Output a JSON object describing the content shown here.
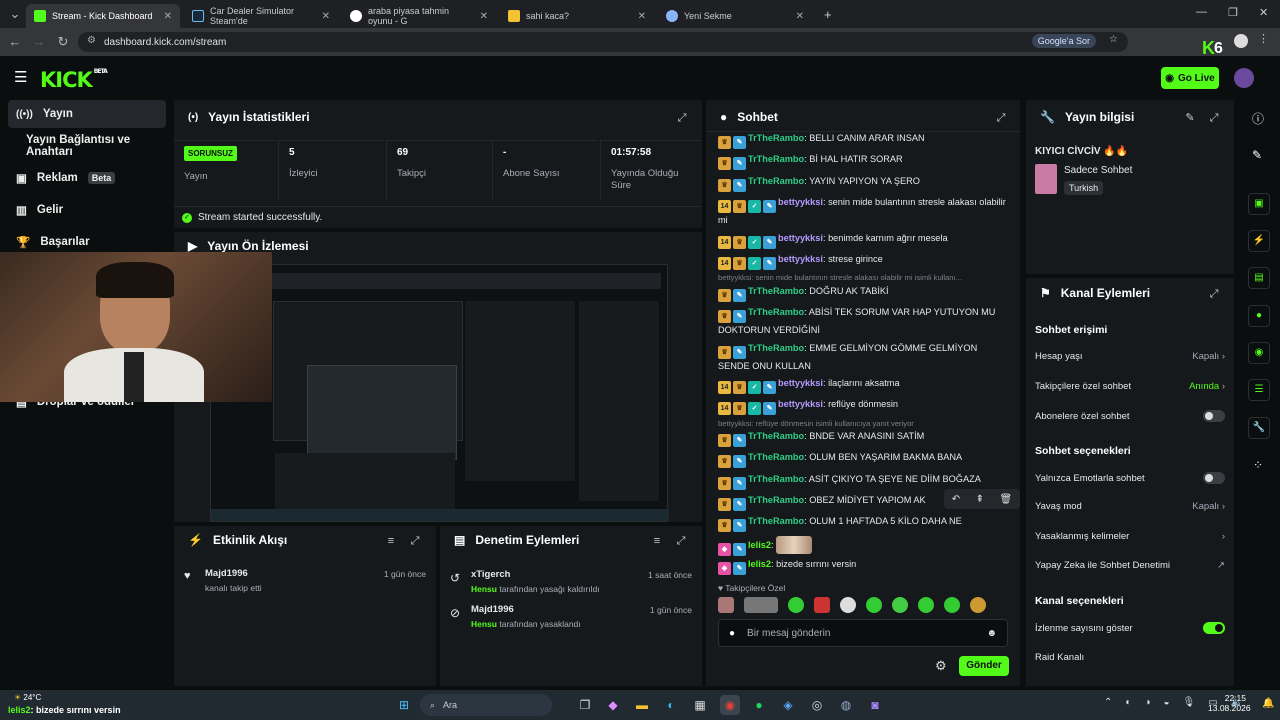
{
  "browser": {
    "tabs": [
      {
        "title": "Stream - Kick Dashboard",
        "active": true
      },
      {
        "title": "Car Dealer Simulator Steam'de"
      },
      {
        "title": "araba piyasa tahmin oyunu - G"
      },
      {
        "title": "sahi kaca?"
      },
      {
        "title": "Yeni Sekme"
      }
    ],
    "url": "dashboard.kick.com/stream",
    "google_label": "Google'a Sor",
    "new_tab": "+"
  },
  "kick": {
    "logo": "KICK",
    "beta": "BETA",
    "go_live": "Go Live"
  },
  "sidebar": {
    "items": [
      {
        "label": "Yayın"
      },
      {
        "label": "Yayın Bağlantısı ve Anahtarı"
      },
      {
        "label": "Reklam",
        "badge": "Beta"
      },
      {
        "label": "Gelir"
      },
      {
        "label": "Başarılar"
      },
      {
        "label": "Droplar ve ödüller"
      }
    ]
  },
  "stats": {
    "title": "Yayın İstatistikleri",
    "status": "SORUNSUZ",
    "status_label": "Yayın",
    "cols": [
      {
        "value": "5",
        "label": "İzleyici"
      },
      {
        "value": "69",
        "label": "Takipçi"
      },
      {
        "value": "-",
        "label": "Abone Sayısı"
      },
      {
        "value": "01:57:58",
        "label": "Yayında Olduğu Süre"
      }
    ],
    "success": "Stream started successfully."
  },
  "preview": {
    "title": "Yayın Ön İzlemesi"
  },
  "activity": {
    "title": "Etkinlik Akışı",
    "items": [
      {
        "user": "Majd1996",
        "text": "kanalı takip etti",
        "time": "1 gün önce"
      }
    ]
  },
  "moderation": {
    "title": "Denetim Eylemleri",
    "items": [
      {
        "user": "xTigerch",
        "mod": "Hensu",
        "text": "tarafından yasağı kaldırıldı",
        "time": "1 saat önce"
      },
      {
        "user": "Majd1996",
        "mod": "Hensu",
        "text": "tarafından yasaklandı",
        "time": "1 gün önce"
      }
    ]
  },
  "chat": {
    "title": "Sohbet",
    "messages": [
      {
        "user": "TrTheRambo",
        "text": "BELLI CANIM ARAR INSAN"
      },
      {
        "user": "TrTheRambo",
        "text": "Bİ HAL HATIR SORAR"
      },
      {
        "user": "TrTheRambo",
        "text": "YAYIN YAPIYON YA ŞERO"
      },
      {
        "user": "bettyykksi",
        "text": "senin mide bulantının stresle alakası olabilir mi"
      },
      {
        "user": "bettyykksi",
        "text": "benimde karnım ağrır mesela"
      },
      {
        "user": "bettyykksi",
        "text": "strese girince"
      },
      {
        "user": "TrTheRambo",
        "text": "DOĞRU AK TABİKİ"
      },
      {
        "user": "TrTheRambo",
        "text": "ABİSİ TEK SORUM VAR HAP YUTUYON MU DOKTORUN VERDİĞİNİ"
      },
      {
        "user": "TrTheRambo",
        "text": "EMME GELMİYON GÖMME GELMİYON SENDE ONU KULLAN"
      },
      {
        "user": "bettyykksi",
        "text": "ilaçlarını aksatma"
      },
      {
        "user": "bettyykksi",
        "text": "reflüye dönmesin"
      },
      {
        "user": "TrTheRambo",
        "text": "BNDE VAR ANASINI SATİM"
      },
      {
        "user": "TrTheRambo",
        "text": "OLUM BEN YAŞARIM BAKMA BANA"
      },
      {
        "user": "TrTheRambo",
        "text": "ASİT ÇIKIYO TA ŞEYE NE DİİM BOĞAZA"
      },
      {
        "user": "TrTheRambo",
        "text": "OBEZ MİDİYET YAPIOM AK"
      },
      {
        "user": "TrTheRambo",
        "text": "OLUM 1 HAFTADA 5 KİLO DAHA NE"
      },
      {
        "user": "lelis2",
        "text": ""
      },
      {
        "user": "lelis2",
        "text": "bizede sırrını versin"
      }
    ],
    "replies": [
      "bettyykksi: senin mide bulantının stresle alakası olabilir mi isimli kullanı...",
      "bettyykksi: reflüye dönmesin isimli kullanıcıya yanıt veriyor"
    ],
    "sub_badge": "14",
    "followers_only": "Takipçilere Özel",
    "input_placeholder": "Bir mesaj gönderin",
    "send": "Gönder",
    "colors": {
      "rambo": "#2ecf86",
      "betty": "#b59aff",
      "lelis": "#53fc18"
    }
  },
  "stream_info": {
    "title": "Yayın bilgisi",
    "stream_title": "KIYICI CİVCİV",
    "category": "Sadece Sohbet",
    "language": "Turkish"
  },
  "channel_actions": {
    "title": "Kanal Eylemleri",
    "chat_access": "Sohbet erişimi",
    "account_age": {
      "label": "Hesap yaşı",
      "value": "Kapalı"
    },
    "followers_chat": {
      "label": "Takipçilere özel sohbet",
      "value": "Anında"
    },
    "subs_chat": {
      "label": "Abonelere özel sohbet"
    },
    "chat_options": "Sohbet seçenekleri",
    "emotes_only": {
      "label": "Yalnızca Emotlarla sohbet"
    },
    "slow_mode": {
      "label": "Yavaş mod",
      "value": "Kapalı"
    },
    "banned_words": {
      "label": "Yasaklanmış kelimeler"
    },
    "ai_moderation": {
      "label": "Yapay Zeka ile Sohbet Denetimi"
    },
    "channel_options": "Kanal seçenekleri",
    "show_views": {
      "label": "İzlenme sayısını göster"
    },
    "raid": {
      "label": "Raid Kanalı"
    }
  },
  "taskbar": {
    "weather": "24°C",
    "search": "Ara",
    "time": "22:15",
    "date": "13.08.2026",
    "overlay_user": "lelis2",
    "overlay_text": ": bizede sırrını versin"
  },
  "overlay": {
    "k6": "6"
  }
}
